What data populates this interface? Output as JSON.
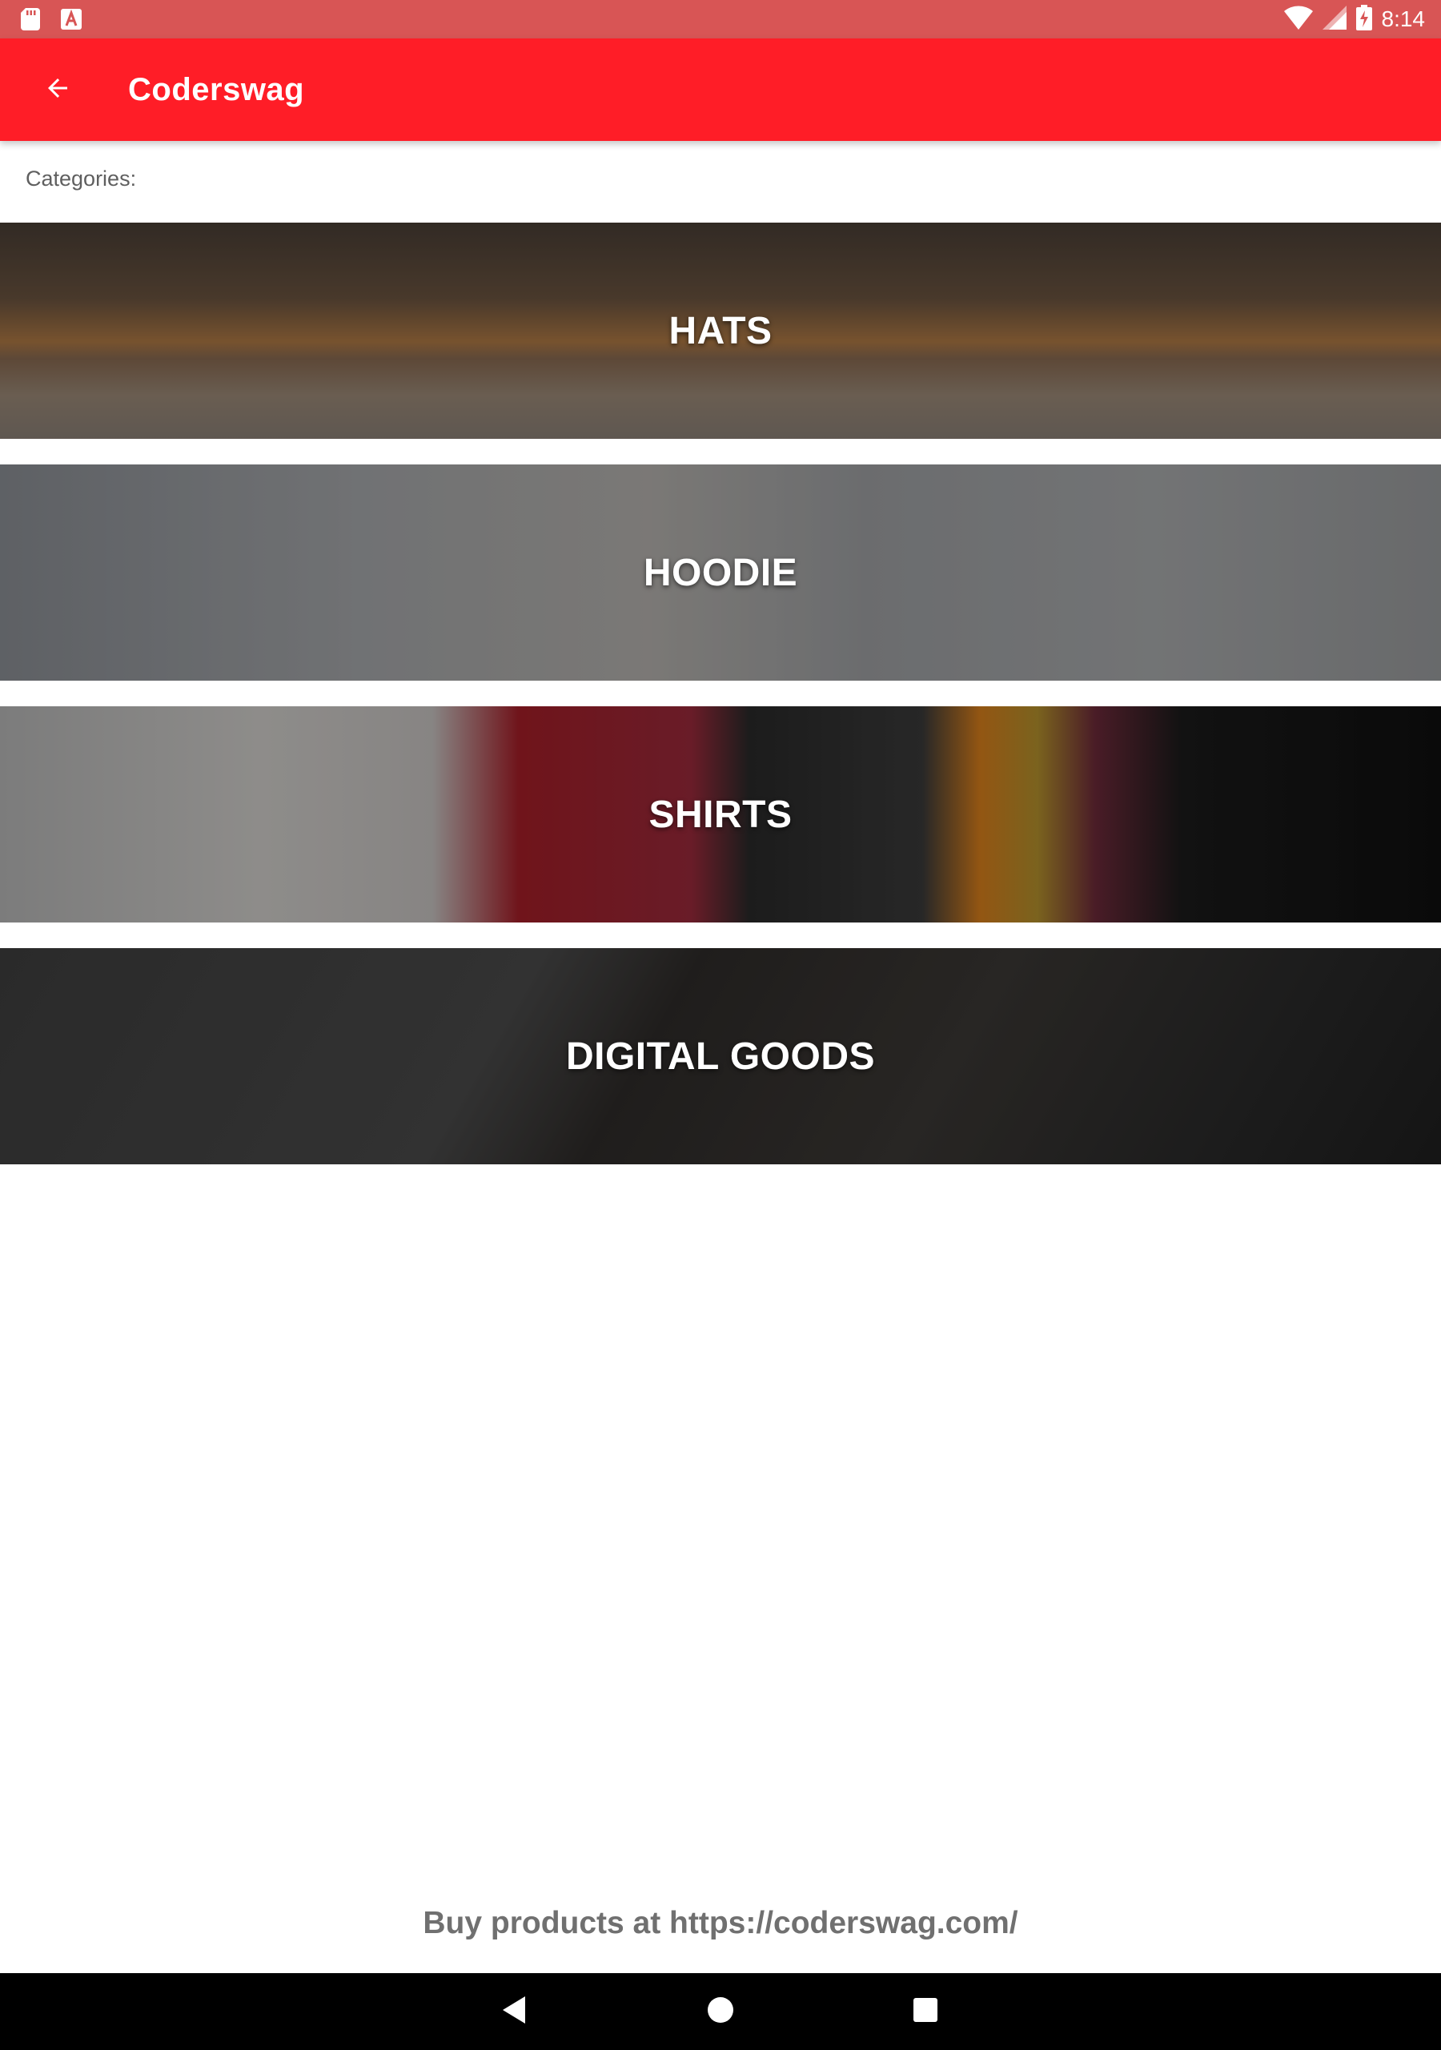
{
  "status_bar": {
    "time": "8:14",
    "left_icons": [
      "sd-card-icon",
      "keyboard-a-icon"
    ],
    "right_icons": [
      "wifi-icon",
      "cellular-signal-icon",
      "battery-charging-icon"
    ]
  },
  "toolbar": {
    "title": "Coderswag",
    "back_icon": "arrow-back-icon",
    "color": "#ff1d27"
  },
  "main": {
    "categories_label": "Categories:",
    "categories": [
      {
        "label": "HATS"
      },
      {
        "label": "HOODIE"
      },
      {
        "label": "SHIRTS"
      },
      {
        "label": "DIGITAL GOODS"
      }
    ]
  },
  "footer": {
    "text": "Buy products at https://coderswag.com/"
  },
  "nav_bar": {
    "buttons": [
      "back-triangle-icon",
      "home-circle-icon",
      "recents-square-icon"
    ]
  }
}
